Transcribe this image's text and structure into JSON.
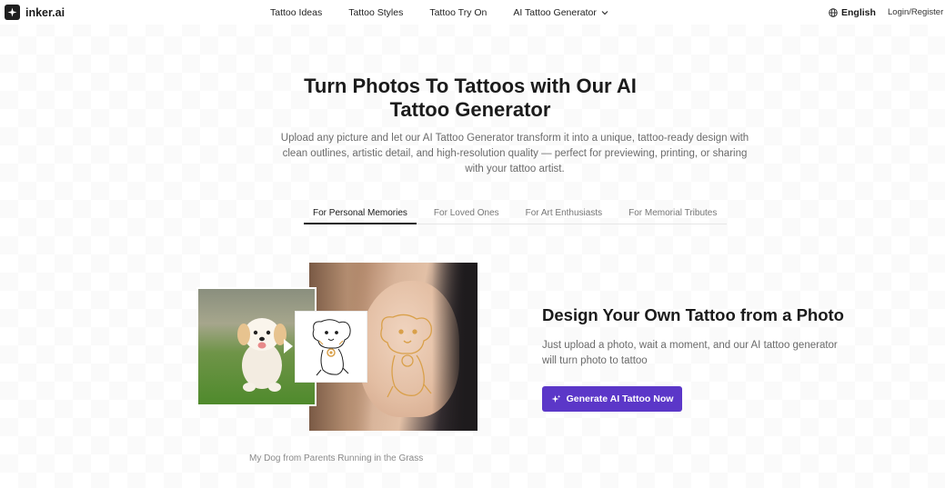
{
  "brand": {
    "name": "inker.ai",
    "icon": "sparkle-logo-icon"
  },
  "nav": {
    "links": [
      {
        "label": "Tattoo Ideas"
      },
      {
        "label": "Tattoo Styles"
      },
      {
        "label": "Tattoo Try On"
      },
      {
        "label": "AI Tattoo Generator",
        "has_dropdown": true
      }
    ],
    "language": {
      "label": "English",
      "icon": "globe-icon"
    },
    "login": "Login/Register"
  },
  "hero": {
    "title": "Turn Photos To Tattoos with Our AI Tattoo Generator",
    "description": "Upload any picture and let our AI Tattoo Generator transform it into a unique, tattoo-ready design with clean outlines, artistic detail, and high-resolution quality — perfect for previewing, printing, or sharing with your tattoo artist."
  },
  "tabs": [
    {
      "label": "For Personal Memories",
      "active": true
    },
    {
      "label": "For Loved Ones",
      "active": false
    },
    {
      "label": "For Art Enthusiasts",
      "active": false
    },
    {
      "label": "For Memorial Tributes",
      "active": false
    }
  ],
  "example": {
    "caption": "My Dog from Parents Running in the Grass"
  },
  "feature": {
    "title": "Design Your Own Tattoo from a Photo",
    "description": "Just upload a photo, wait a moment, and our AI tattoo generator will turn photo to tattoo",
    "cta_label": "Generate AI Tattoo Now",
    "cta_icon": "sparkle-icon"
  },
  "colors": {
    "accent": "#5b37c8",
    "text": "#1b1b1b",
    "muted": "#6b6b6b",
    "tattoo_line": "#d9a04a"
  }
}
